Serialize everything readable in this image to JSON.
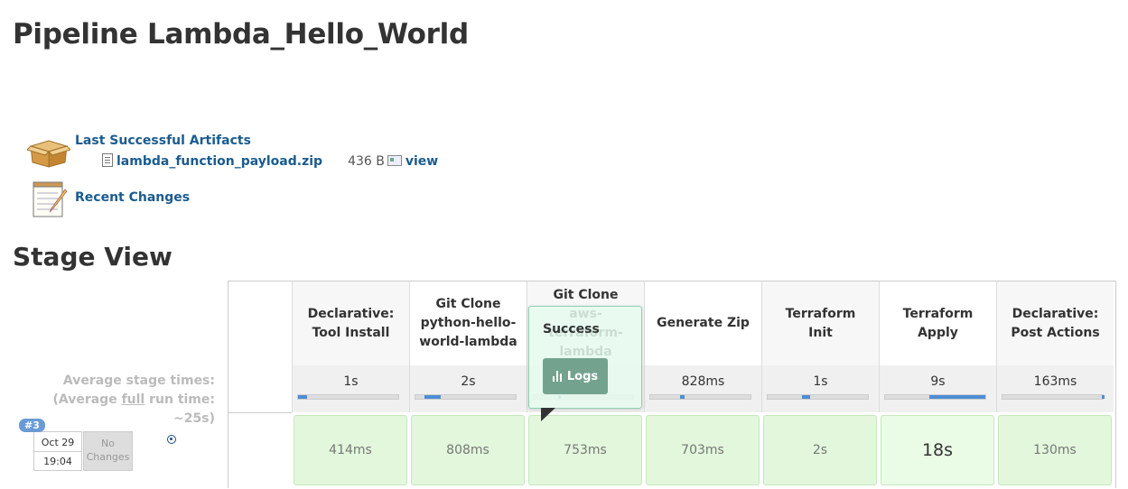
{
  "page": {
    "title": "Pipeline Lambda_Hello_World"
  },
  "artifacts": {
    "title": "Last Successful Artifacts",
    "file_name": "lambda_function_payload.zip",
    "file_size": "436 B",
    "view_label": "view"
  },
  "recent_changes": {
    "label": "Recent Changes"
  },
  "stage_view": {
    "title": "Stage View",
    "avg_label_line1": "Average stage times:",
    "avg_label_prefix": "(Average ",
    "avg_label_full": "full",
    "avg_label_suffix": " run time: ~25s)",
    "stages": [
      {
        "name": "Declarative: Tool Install",
        "avg": "1s",
        "fill_start": 0.0,
        "fill_width": 0.09
      },
      {
        "name": "Git Clone python-hello-world-lambda",
        "avg": "2s",
        "fill_start": 0.09,
        "fill_width": 0.16
      },
      {
        "name": "Git Clone aws-terraform-lambda",
        "avg": "753ms",
        "fill_start": 0.25,
        "fill_width": 0.03
      },
      {
        "name": "Generate Zip",
        "avg": "828ms",
        "fill_start": 0.3,
        "fill_width": 0.04
      },
      {
        "name": "Terraform Init",
        "avg": "1s",
        "fill_start": 0.34,
        "fill_width": 0.08
      },
      {
        "name": "Terraform Apply",
        "avg": "9s",
        "fill_start": 0.44,
        "fill_width": 0.56
      },
      {
        "name": "Declarative: Post Actions",
        "avg": "163ms",
        "fill_start": 0.99,
        "fill_width": 0.01
      }
    ],
    "run": {
      "build_number": "#3",
      "date": "Oct 29",
      "time": "19:04",
      "changes": "No Changes",
      "durations": [
        "414ms",
        "808ms",
        "753ms",
        "703ms",
        "2s",
        "18s",
        "130ms"
      ]
    },
    "popover": {
      "status": "Success",
      "logs_label": "Logs"
    }
  },
  "colors": {
    "link": "#1b5c8f",
    "success_cell": "#e2f7dc",
    "progress": "#4c8ed4"
  }
}
